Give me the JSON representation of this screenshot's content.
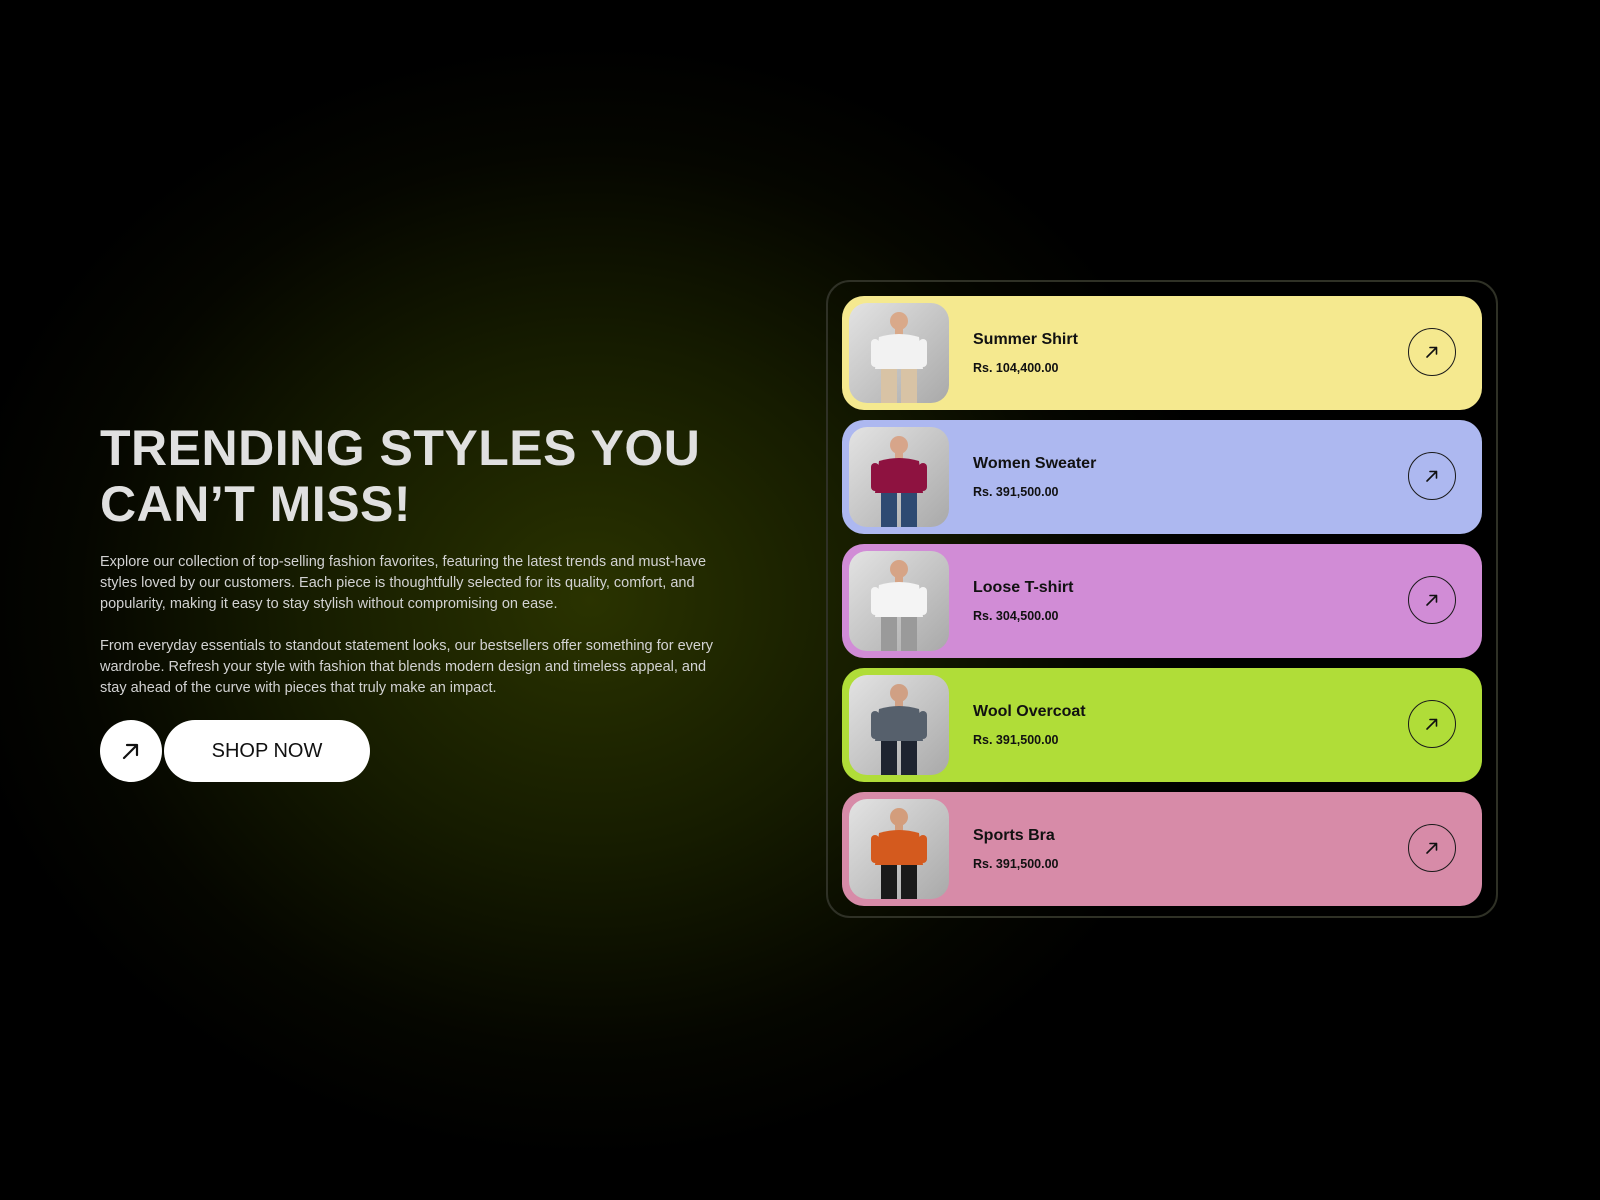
{
  "hero": {
    "title_line1": "TRENDING STYLES YOU",
    "title_line2": "CAN’T MISS!",
    "paragraph1": "Explore our collection of top-selling fashion favorites, featuring the latest trends and must-have styles loved by our customers. Each piece is thoughtfully selected for its quality, comfort, and popularity, making it easy to stay stylish without compromising on ease.",
    "paragraph2": "From everyday essentials to standout statement looks, our bestsellers offer something for every wardrobe. Refresh your style with fashion that blends modern design and timeless appeal, and stay ahead of the curve with pieces that truly make an impact.",
    "cta_label": "SHOP NOW",
    "cta_icon": "arrow-up-right-icon"
  },
  "products": [
    {
      "name": "Summer Shirt",
      "price": "Rs. 104,400.00",
      "bg": "#f5e98f",
      "shirt": "#f2f2f2",
      "pants": "#d8c3a5",
      "skin": "#d9a98a"
    },
    {
      "name": "Women Sweater",
      "price": "Rs. 391,500.00",
      "bg": "#adb8f0",
      "shirt": "#8e1240",
      "pants": "#2e4a72",
      "skin": "#d7a58a"
    },
    {
      "name": "Loose T-shirt",
      "price": "Rs. 304,500.00",
      "bg": "#d18cd6",
      "shirt": "#f4f4f4",
      "pants": "#9a9a9a",
      "skin": "#d6a486"
    },
    {
      "name": "Wool Overcoat",
      "price": "Rs. 391,500.00",
      "bg": "#b0dd38",
      "shirt": "#56606c",
      "pants": "#1e2430",
      "skin": "#d0a084"
    },
    {
      "name": "Sports Bra",
      "price": "Rs. 391,500.00",
      "bg": "#d78ba8",
      "shirt": "#d45a1e",
      "pants": "#1a1a1a",
      "skin": "#d39d7c"
    }
  ],
  "colors": {
    "accent_dark": "#111111",
    "background": "#000000",
    "glow": "#2a3300"
  }
}
